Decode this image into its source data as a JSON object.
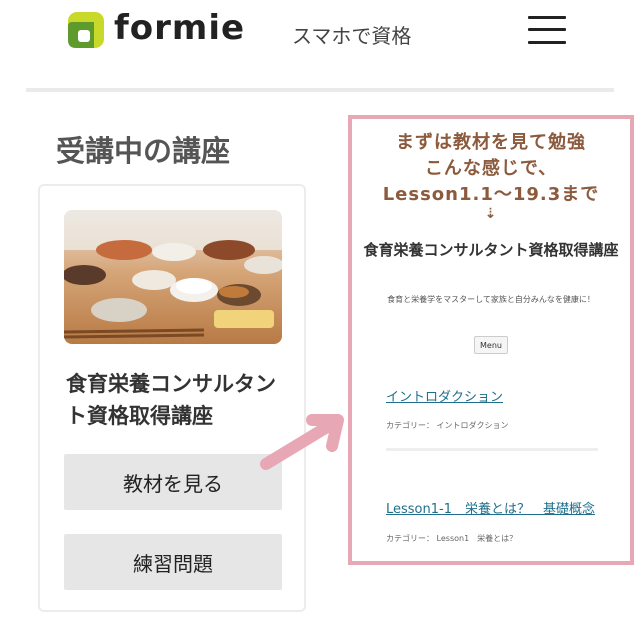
{
  "header": {
    "logo_text": "formie",
    "tagline": "スマホで資格"
  },
  "section_title": "受講中の講座",
  "course": {
    "title": "食育栄養コンサルタント資格取得講座",
    "materials_button": "教材を見る",
    "exercises_button": "練習問題"
  },
  "annotation": {
    "line1": "まずは教材を見て勉強",
    "line2": "こんな感じで、",
    "line3": "Lesson1.1〜19.3まで",
    "arrow": "⇣"
  },
  "preview": {
    "title": "食育栄養コンサルタント資格取得講座",
    "description": "食育と栄養学をマスターして家族と自分みんなを健康に！",
    "menu_button": "Menu",
    "posts": [
      {
        "title": "イントロダクション",
        "category": "カテゴリー： イントロダクション"
      },
      {
        "title": "Lesson1-1　栄養とは？　基礎概念",
        "category": "カテゴリー： Lesson1　栄養とは？"
      }
    ]
  },
  "colors": {
    "brand_green": "#9bc22a",
    "highlight_pink": "#e8a7b5",
    "annotation_brown": "#8c5a3c",
    "link_blue": "#1f6f8b"
  },
  "icons": [
    "formie-logo-icon",
    "hamburger-menu-icon",
    "pointer-arrow-icon"
  ]
}
